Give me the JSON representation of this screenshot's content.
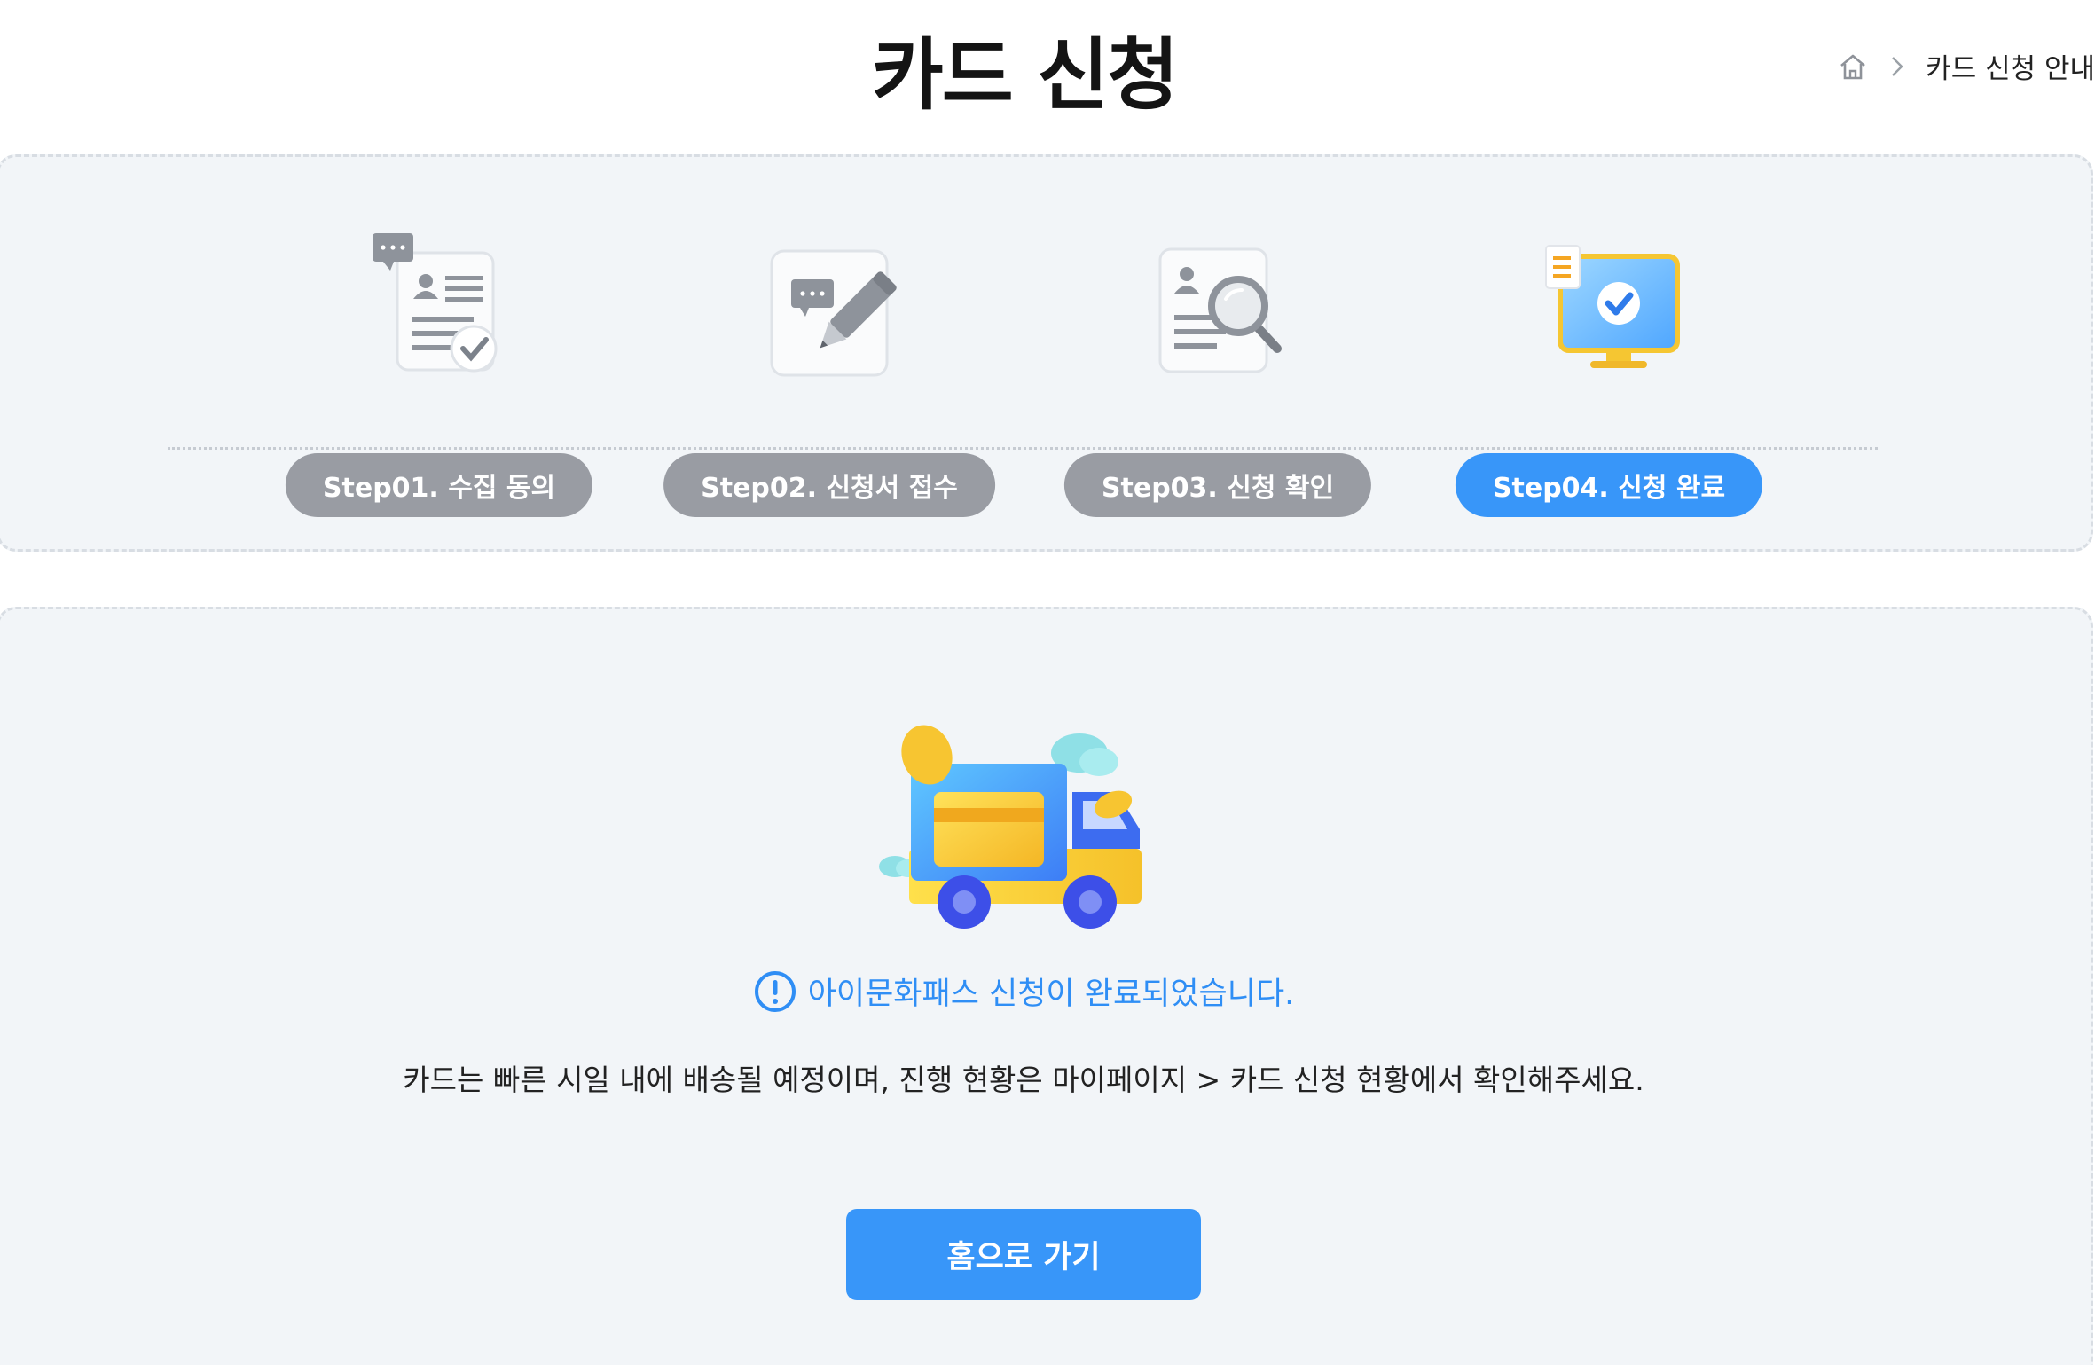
{
  "header": {
    "title": "카드 신청",
    "breadcrumb": {
      "home_icon": "home-icon",
      "separator_icon": "chevron-right-icon",
      "current": "카드 신청 안내"
    }
  },
  "steps": [
    {
      "label": "Step01. 수집 동의",
      "icon": "consent-document-icon",
      "active": false
    },
    {
      "label": "Step02. 신청서 접수",
      "icon": "write-application-icon",
      "active": false
    },
    {
      "label": "Step03. 신청 확인",
      "icon": "document-search-icon",
      "active": false
    },
    {
      "label": "Step04. 신청 완료",
      "icon": "monitor-check-icon",
      "active": true
    }
  ],
  "completion": {
    "illustration": "delivery-truck-card-icon",
    "notice_icon": "exclamation-circle-icon",
    "notice": "아이문화패스 신청이 완료되었습니다.",
    "description": "카드는 빠른 시일 내에 배송될 예정이며, 진행 현황은 마이페이지 > 카드 신청 현황에서 확인해주세요.",
    "home_button": "홈으로 가기"
  },
  "colors": {
    "accent": "#3896f9",
    "inactive_step": "#999ca3",
    "panel_bg": "#f2f5f8"
  }
}
